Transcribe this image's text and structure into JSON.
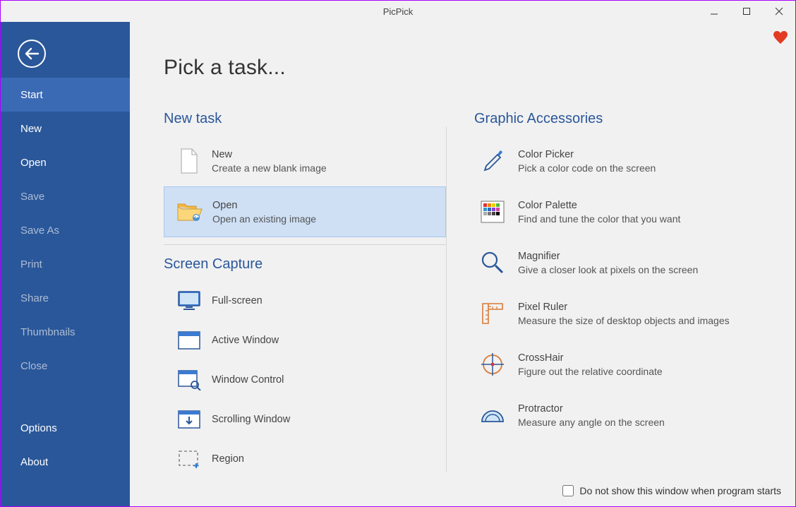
{
  "window": {
    "title": "PicPick"
  },
  "sidebar": {
    "items": [
      {
        "label": "Start",
        "active": true,
        "disabled": false
      },
      {
        "label": "New",
        "active": false,
        "disabled": false
      },
      {
        "label": "Open",
        "active": false,
        "disabled": false
      },
      {
        "label": "Save",
        "active": false,
        "disabled": true
      },
      {
        "label": "Save As",
        "active": false,
        "disabled": true
      },
      {
        "label": "Print",
        "active": false,
        "disabled": true
      },
      {
        "label": "Share",
        "active": false,
        "disabled": true
      },
      {
        "label": "Thumbnails",
        "active": false,
        "disabled": true
      },
      {
        "label": "Close",
        "active": false,
        "disabled": true
      }
    ],
    "footer": [
      {
        "label": "Options"
      },
      {
        "label": "About"
      }
    ]
  },
  "page_title": "Pick a task...",
  "new_task": {
    "heading": "New task",
    "items": [
      {
        "title": "New",
        "desc": "Create a new blank image",
        "selected": false,
        "name": "task-new"
      },
      {
        "title": "Open",
        "desc": "Open an existing image",
        "selected": true,
        "name": "task-open"
      }
    ]
  },
  "screen_capture": {
    "heading": "Screen Capture",
    "items": [
      {
        "label": "Full-screen",
        "name": "capture-fullscreen"
      },
      {
        "label": "Active Window",
        "name": "capture-active-window"
      },
      {
        "label": "Window Control",
        "name": "capture-window-control"
      },
      {
        "label": "Scrolling Window",
        "name": "capture-scrolling"
      },
      {
        "label": "Region",
        "name": "capture-region"
      }
    ]
  },
  "accessories": {
    "heading": "Graphic Accessories",
    "items": [
      {
        "title": "Color Picker",
        "desc": "Pick a color code on the screen",
        "name": "acc-color-picker"
      },
      {
        "title": "Color Palette",
        "desc": "Find and tune the color that you want",
        "name": "acc-color-palette"
      },
      {
        "title": "Magnifier",
        "desc": "Give a closer look at pixels on the screen",
        "name": "acc-magnifier"
      },
      {
        "title": "Pixel Ruler",
        "desc": "Measure the size of desktop objects and images",
        "name": "acc-pixel-ruler"
      },
      {
        "title": "CrossHair",
        "desc": "Figure out the relative coordinate",
        "name": "acc-crosshair"
      },
      {
        "title": "Protractor",
        "desc": "Measure any angle on the screen",
        "name": "acc-protractor"
      }
    ]
  },
  "footer_check": {
    "label": "Do not show this window when program starts",
    "checked": false
  },
  "colors": {
    "primary": "#2a579a",
    "orange": "#d97b36"
  }
}
